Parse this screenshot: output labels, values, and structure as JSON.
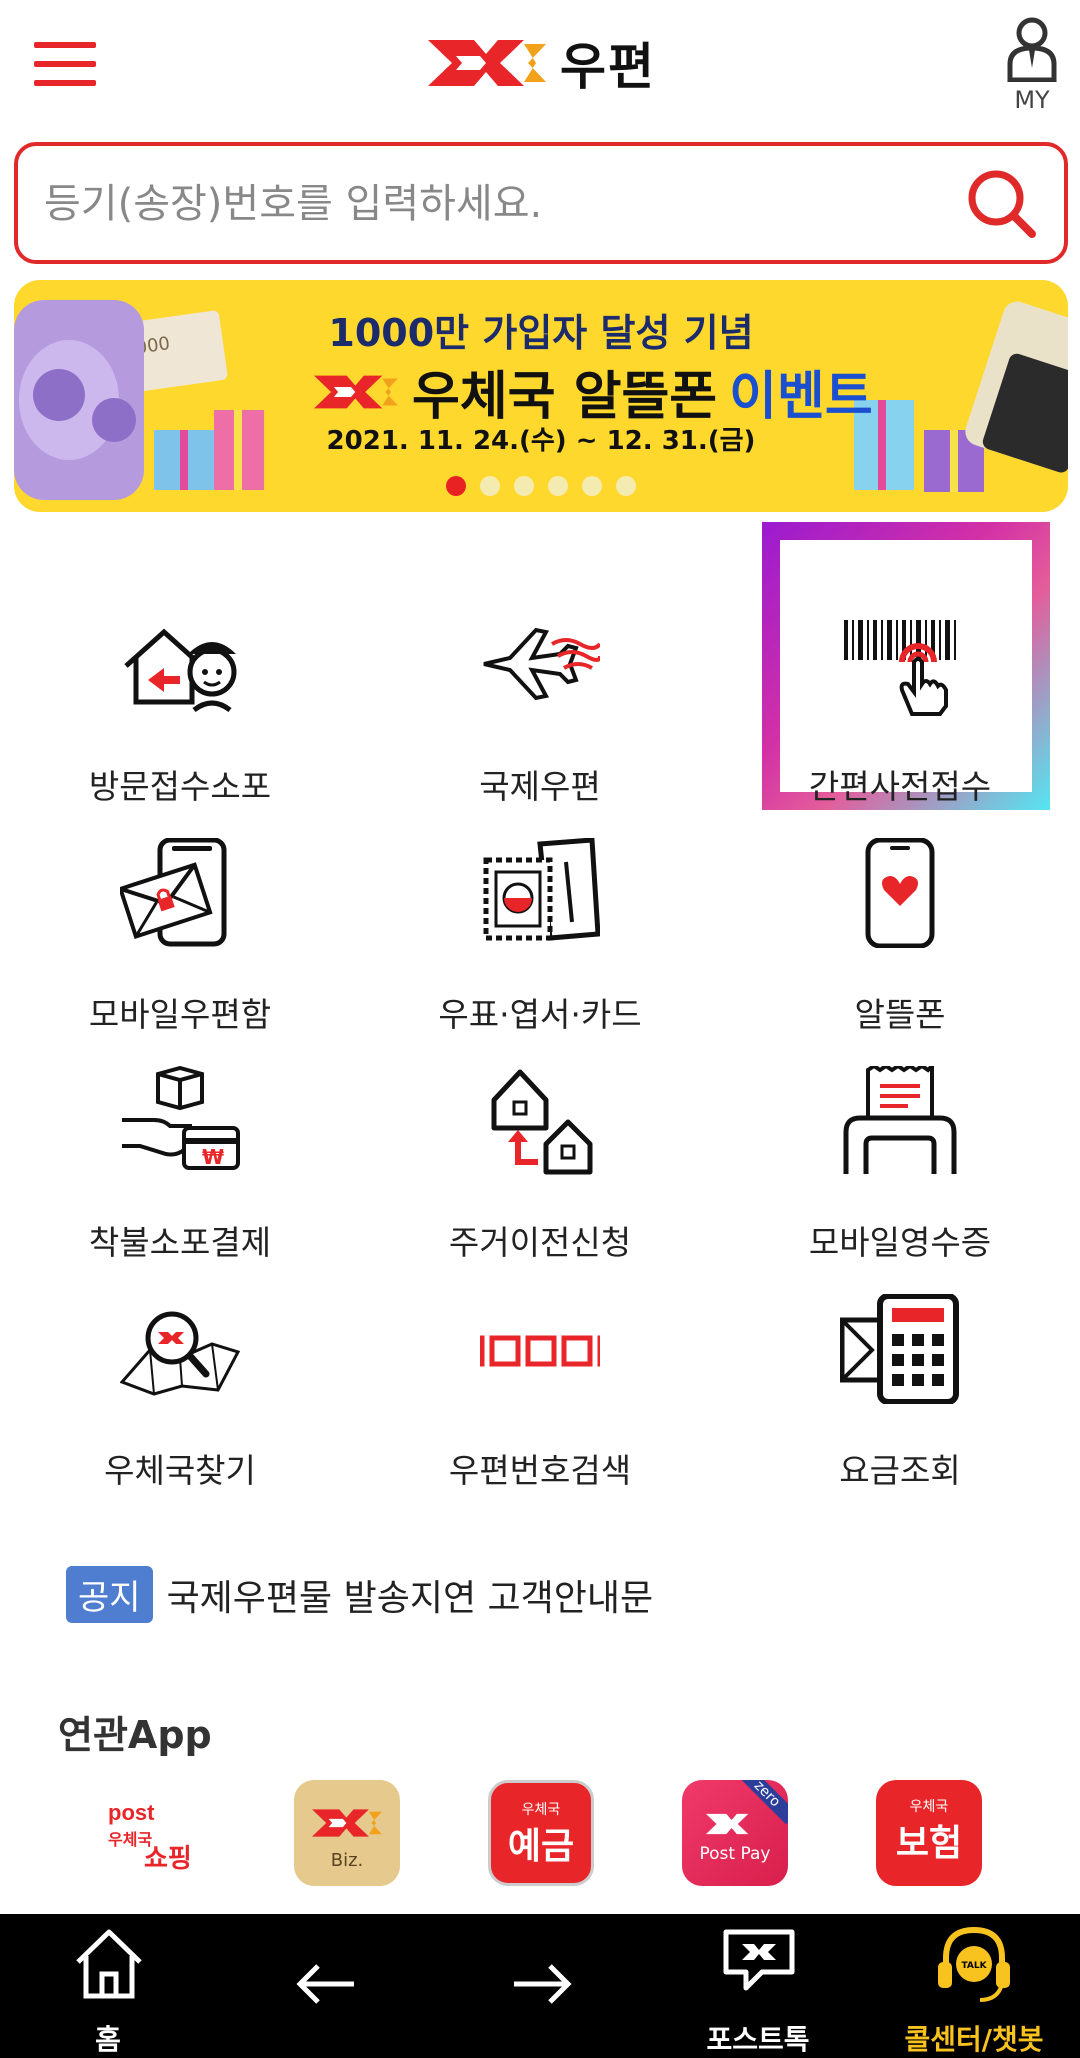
{
  "header": {
    "brand": "우편",
    "my_label": "MY"
  },
  "search": {
    "placeholder": "등기(송장)번호를 입력하세요."
  },
  "banner": {
    "headline": "1000만 가입자 달성 기념",
    "title": "우체국 알뜰폰",
    "title_accent": "이벤트",
    "date": "2021. 11. 24.(수) ~ 12. 31.(금)",
    "slide_count": 6,
    "active_slide": 1
  },
  "menu": [
    {
      "label": "방문접수소포",
      "icon": "pickup-parcel-icon"
    },
    {
      "label": "국제우편",
      "icon": "airplane-icon"
    },
    {
      "label": "간편사전접수",
      "icon": "barcode-touch-icon"
    },
    {
      "label": "모바일우편함",
      "icon": "mobile-mailbox-icon"
    },
    {
      "label": "우표·엽서·카드",
      "icon": "stamp-icon"
    },
    {
      "label": "알뜰폰",
      "icon": "phone-heart-icon"
    },
    {
      "label": "착불소포결제",
      "icon": "cod-payment-icon"
    },
    {
      "label": "주거이전신청",
      "icon": "move-house-icon"
    },
    {
      "label": "모바일영수증",
      "icon": "receipt-printer-icon"
    },
    {
      "label": "우체국찾기",
      "icon": "map-search-icon"
    },
    {
      "label": "우편번호검색",
      "icon": "postcode-boxes-icon"
    },
    {
      "label": "요금조회",
      "icon": "calculator-icon"
    }
  ],
  "notice": {
    "badge": "공지",
    "text": "국제우편물 발송지연 고객안내문"
  },
  "related": {
    "title": "연관App",
    "apps": [
      {
        "name": "post mall 우체국쇼핑",
        "line1": "post",
        "line2": "우체국",
        "line3": "쇼핑"
      },
      {
        "name": "Biz",
        "label": "Biz."
      },
      {
        "name": "우체국 예금",
        "small": "우체국",
        "big": "예금"
      },
      {
        "name": "Post Pay zero",
        "label": "Post Pay",
        "tag": "zero"
      },
      {
        "name": "우체국 보험",
        "small": "우체국",
        "big": "보험"
      }
    ]
  },
  "bottom_nav": {
    "home": "홈",
    "posttalk": "포스트톡",
    "callcenter": "콜센터/챗봇",
    "talk_tag": "TALK"
  },
  "colors": {
    "brand_red": "#e8262a",
    "banner_yellow": "#ffd82e",
    "notice_blue": "#4f7ed0",
    "callcenter_yellow": "#f8c21f"
  }
}
